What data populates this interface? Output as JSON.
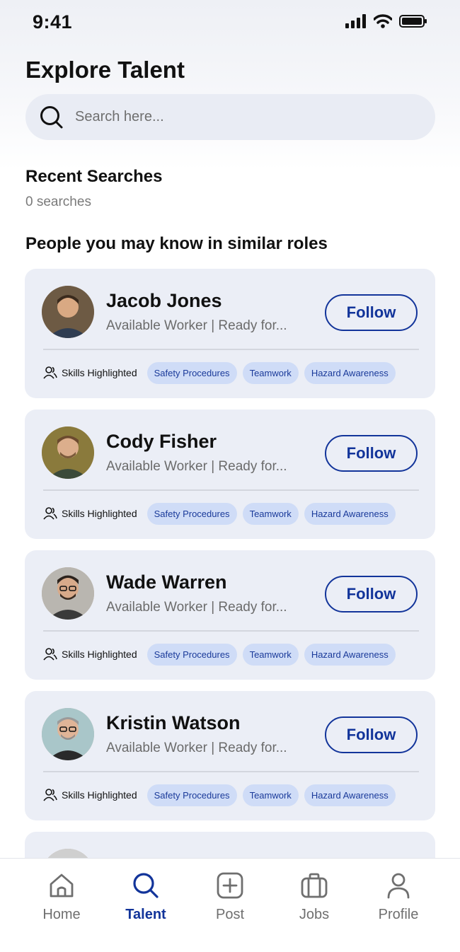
{
  "status_bar": {
    "time": "9:41"
  },
  "header": {
    "title": "Explore Talent"
  },
  "search": {
    "placeholder": "Search here..."
  },
  "recent": {
    "title": "Recent Searches",
    "count_text": "0 searches"
  },
  "people": {
    "title": "People you may know in similar roles",
    "skills_label": "Skills Highlighted",
    "follow_label": "Follow",
    "cards": [
      {
        "name": "Jacob Jones",
        "status": "Available Worker | Ready for...",
        "tags": [
          "Safety Procedures",
          "Teamwork",
          "Hazard Awareness"
        ]
      },
      {
        "name": "Cody Fisher",
        "status": "Available Worker | Ready for...",
        "tags": [
          "Safety Procedures",
          "Teamwork",
          "Hazard Awareness"
        ]
      },
      {
        "name": "Wade Warren",
        "status": "Available Worker | Ready for...",
        "tags": [
          "Safety Procedures",
          "Teamwork",
          "Hazard Awareness"
        ]
      },
      {
        "name": "Kristin Watson",
        "status": "Available Worker | Ready for...",
        "tags": [
          "Safety Procedures",
          "Teamwork",
          "Hazard Awareness"
        ]
      }
    ]
  },
  "nav": {
    "items": [
      {
        "label": "Home",
        "icon": "home-icon"
      },
      {
        "label": "Talent",
        "icon": "search-icon",
        "active": true
      },
      {
        "label": "Post",
        "icon": "plus-square-icon"
      },
      {
        "label": "Jobs",
        "icon": "briefcase-icon"
      },
      {
        "label": "Profile",
        "icon": "user-icon"
      }
    ]
  },
  "colors": {
    "accent": "#12349a",
    "card_bg": "#ebeef6",
    "tag_bg": "#cfdcf7"
  }
}
